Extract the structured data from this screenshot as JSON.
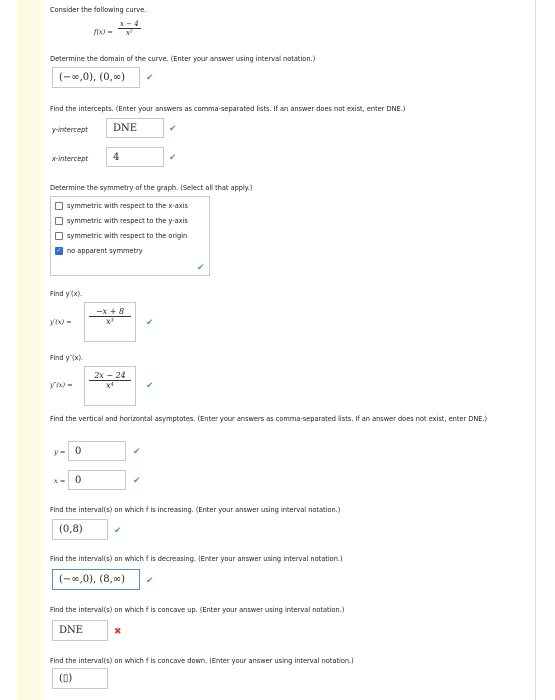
{
  "intro": "Consider the following curve.",
  "function": {
    "lhs": "f(x) =",
    "num": "x − 4",
    "den": "x²"
  },
  "domain": {
    "prompt": "Determine the domain of the curve. (Enter your answer using interval notation.)",
    "answer": "(−∞,0), (0,∞)"
  },
  "intercepts": {
    "prompt": "Find the intercepts. (Enter your answers as comma-separated lists. If an answer does not exist, enter DNE.)",
    "y_label": "y-intercept",
    "y_value": "DNE",
    "x_label": "x-intercept",
    "x_value": "4"
  },
  "symmetry": {
    "prompt": "Determine the symmetry of the graph. (Select all that apply.)",
    "options": [
      {
        "label": "symmetric with respect to the x-axis",
        "checked": false
      },
      {
        "label": "symmetric with respect to the y-axis",
        "checked": false
      },
      {
        "label": "symmetric with respect to the origin",
        "checked": false
      },
      {
        "label": "no apparent symmetry",
        "checked": true
      }
    ]
  },
  "first_derivative": {
    "prompt": "Find y′(x).",
    "lhs": "y′(x) =",
    "num": "−x + 8",
    "den": "x³"
  },
  "second_derivative": {
    "prompt": "Find y″(x).",
    "lhs": "y″(x) =",
    "num": "2x − 24",
    "den": "x⁴"
  },
  "asymptotes": {
    "prompt": "Find the vertical and horizontal asymptotes. (Enter your answers as comma-separated lists. If an answer does not exist, enter DNE.)",
    "y_label": "y =",
    "y_value": "0",
    "x_label": "x =",
    "x_value": "0"
  },
  "increasing": {
    "prompt": "Find the interval(s) on which f is increasing. (Enter your answer using interval notation.)",
    "answer": "(0,8)"
  },
  "decreasing": {
    "prompt": "Find the interval(s) on which f is decreasing. (Enter your answer using interval notation.)",
    "answer": "(−∞,0), (8,∞)"
  },
  "concave_up": {
    "prompt": "Find the interval(s) on which f is concave up. (Enter your answer using interval notation.)",
    "answer": "DNE"
  },
  "concave_down": {
    "prompt": "Find the interval(s) on which f is concave down. (Enter your answer using interval notation.)",
    "answer": "(▯)"
  },
  "colors": {
    "check": "#4caf50",
    "cross": "#e53935",
    "rail": "#fdfbe1",
    "checkbox": "#2a6fd6"
  }
}
